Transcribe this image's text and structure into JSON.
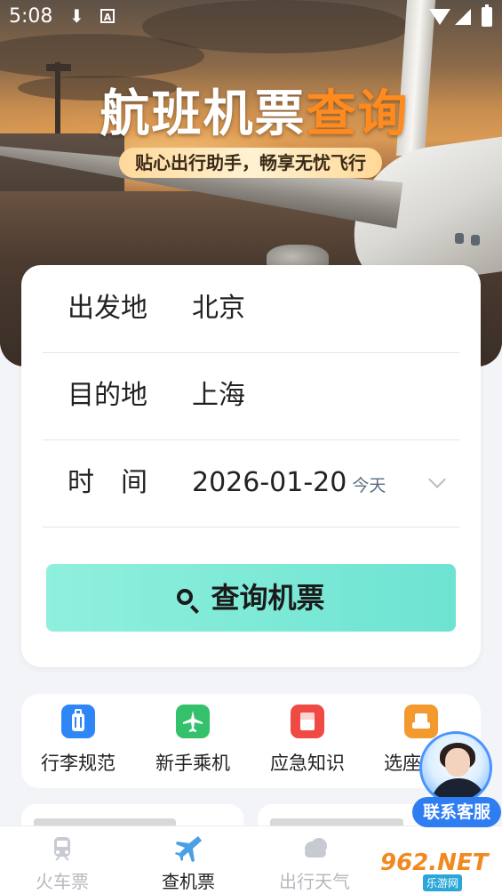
{
  "status_bar": {
    "time": "5:08"
  },
  "hero": {
    "title_white": "航班机票",
    "title_orange": "查询",
    "subtitle": "贴心出行助手，畅享无忧飞行"
  },
  "search_form": {
    "departure": {
      "label": "出发地",
      "value": "北京"
    },
    "destination": {
      "label": "目的地",
      "value": "上海"
    },
    "date": {
      "label": "时　间",
      "value": "2026-01-20",
      "hint": "今天"
    },
    "search_button": "查询机票"
  },
  "quick_links": [
    {
      "label": "行李规范",
      "icon": "luggage-icon",
      "color": "#2f86f6"
    },
    {
      "label": "新手乘机",
      "icon": "airplane-icon",
      "color": "#35c16b"
    },
    {
      "label": "应急知识",
      "icon": "first-aid-icon",
      "color": "#f04a44"
    },
    {
      "label": "选座",
      "icon": "seat-icon",
      "color": "#f3992e"
    }
  ],
  "customer_service": {
    "label": "联系客服"
  },
  "watermark": {
    "mark": "962.NET",
    "sub": "乐游网"
  },
  "tab_bar": [
    {
      "label": "火车票",
      "icon": "train-icon",
      "active": false
    },
    {
      "label": "查机票",
      "icon": "airplane-icon",
      "active": true
    },
    {
      "label": "出行天气",
      "icon": "cloud-icon",
      "active": false
    }
  ],
  "colors": {
    "accent_button": "#7ae9d7",
    "hero_orange": "#ff8a1e",
    "service_blue": "#2f7df2"
  }
}
